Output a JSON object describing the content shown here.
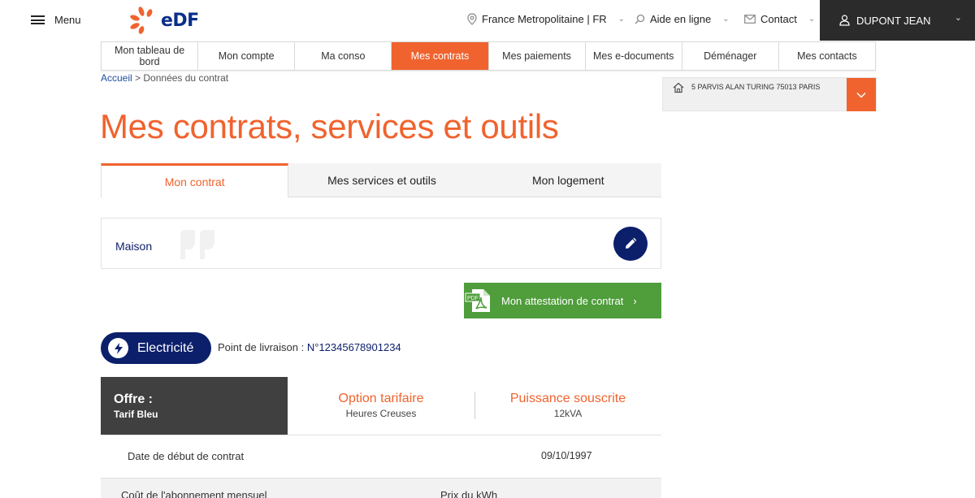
{
  "header": {
    "menu_label": "Menu",
    "logo_text": "eDF",
    "region_label": "France Metropolitaine | FR",
    "help_label": "Aide en ligne",
    "contact_label": "Contact",
    "user_name": "DUPONT JEAN"
  },
  "nav": {
    "items": [
      {
        "label": "Mon tableau de bord"
      },
      {
        "label": "Mon compte"
      },
      {
        "label": "Ma conso"
      },
      {
        "label": "Mes contrats"
      },
      {
        "label": "Mes paiements"
      },
      {
        "label": "Mes e-documents"
      },
      {
        "label": "Déménager"
      },
      {
        "label": "Mes contacts"
      }
    ],
    "active_index": 3
  },
  "breadcrumb": {
    "home": "Accueil",
    "separator": ">",
    "current": "Données du contrat"
  },
  "address": {
    "text": "5 PARVIS ALAN TURING 75013 PARIS"
  },
  "page": {
    "title": "Mes contrats, services et outils"
  },
  "tabs": [
    {
      "label": "Mon contrat"
    },
    {
      "label": "Mes services et outils"
    },
    {
      "label": "Mon logement"
    }
  ],
  "home_card": {
    "name": "Maison"
  },
  "attestation": {
    "label": "Mon attestation de contrat",
    "pdf_badge": "PDF"
  },
  "energy": {
    "label": "Electricité",
    "delivery_label": "Point de livraison :",
    "delivery_value": "N°12345678901234"
  },
  "offer": {
    "offer_label": "Offre :",
    "offer_value": "Tarif Bleu",
    "option_title": "Option tarifaire",
    "option_value": "Heures Creuses",
    "power_title": "Puissance souscrite",
    "power_value": "12kVA"
  },
  "details": {
    "start_date_label": "Date de début de contrat",
    "start_date_value": "09/10/1997",
    "subscription_label": "Coût de l'abonnement mensuel",
    "kwh_price_label": "Prix du kWh"
  },
  "colors": {
    "brand_orange": "#f0632e",
    "brand_navy": "#0c1f6b",
    "pdf_green": "#4f9d3b",
    "dark_block": "#404040"
  }
}
